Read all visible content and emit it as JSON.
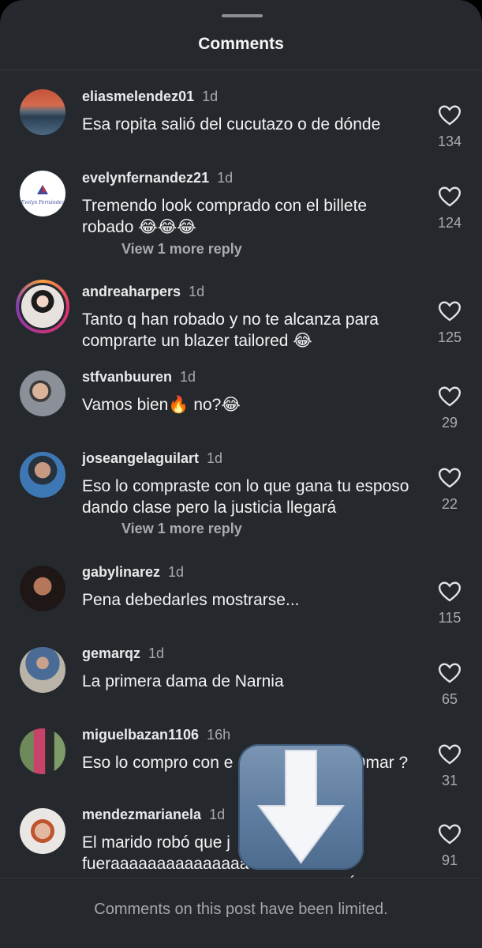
{
  "header": {
    "title": "Comments"
  },
  "comments": [
    {
      "username": "eliasmelendez01",
      "time": "1d",
      "text": "Esa ropita salió del cucutazo o de dónde",
      "likes": "134",
      "more": ""
    },
    {
      "username": "evelynfernandez21",
      "time": "1d",
      "text": "Tremendo look comprado con el billete robado 😂😂😂",
      "likes": "124",
      "more": "View 1 more reply",
      "avatar_text": "Evelyn Fernández"
    },
    {
      "username": "andreaharpers",
      "time": "1d",
      "text": "Tanto q han robado y no te alcanza para comprarte un blazer tailored 😂",
      "likes": "125",
      "more": ""
    },
    {
      "username": "stfvanbuuren",
      "time": "1d",
      "text": "Vamos bien🔥 no?😂",
      "likes": "29",
      "more": ""
    },
    {
      "username": "joseangelaguilart",
      "time": "1d",
      "text": "Eso lo compraste con lo que gana tu esposo dando clase pero la justicia llegará",
      "likes": "22",
      "more": "View 1 more reply"
    },
    {
      "username": "gabylinarez",
      "time": "1d",
      "text": "Pena debedarles mostrarse...",
      "likes": "115",
      "more": ""
    },
    {
      "username": "gemarqz",
      "time": "1d",
      "text": "La primera dama de Narnia",
      "likes": "65",
      "more": ""
    },
    {
      "username": "miguelbazan1106",
      "time": "16h",
      "text": "Eso lo compro con e                          Omar ?",
      "likes": "31",
      "more": ""
    },
    {
      "username": "mendezmarianela",
      "time": "1d",
      "text": "El marido robó que j                                      fueraaaaaaaaaaaaaaa                              AAAAA AAAA EL MARIDO SE ROBÓ DE TODOS",
      "likes": "91",
      "more": ""
    }
  ],
  "footer": {
    "text": "Comments on this post have been limited."
  },
  "overlay": {
    "icon": "download-arrow-icon",
    "color": "#6683a6"
  }
}
